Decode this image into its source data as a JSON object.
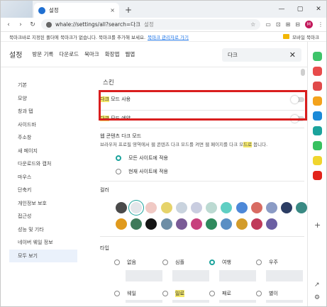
{
  "tab": {
    "title": "설정",
    "close": "×",
    "new": "+"
  },
  "window": {
    "min": "—",
    "max": "▢",
    "close": "✕"
  },
  "address": {
    "scheme": "whale://settings/all?search=",
    "query": "다크",
    "label": "설정"
  },
  "avatar_letter": "M",
  "bookmarks": {
    "notice": "북마크바로 지정된 폴더에 북마크가 없습니다. 북마크를 추가해 보세요.",
    "link": "북마크 관리자로 가기",
    "folder": "모바일 북마크"
  },
  "header": {
    "title": "설정",
    "nav": [
      "방문 기록",
      "다운로드",
      "북마크",
      "확장앱",
      "웹앱"
    ]
  },
  "search": {
    "value": "다크"
  },
  "sidebar": [
    {
      "label": "기본"
    },
    {
      "label": "모양"
    },
    {
      "label": "창과 탭"
    },
    {
      "label": "사이드바"
    },
    {
      "label": "주소창"
    },
    {
      "label": "새 페이지"
    },
    {
      "label": "다운로드와 캡처"
    },
    {
      "label": "마우스"
    },
    {
      "label": "단축키"
    },
    {
      "label": "개인정보 보호"
    },
    {
      "label": "접근성"
    },
    {
      "label": "성능 및 기타"
    },
    {
      "label": "네이버 웨일 정보"
    },
    {
      "label": "모두 보기"
    }
  ],
  "skin": {
    "title": "스킨",
    "dark_use": {
      "hl": "다크",
      "rest": " 모드 사용"
    },
    "dark_reserve": {
      "hl": "다크",
      "rest": " 모드 예약"
    },
    "webcontent_title": "웹 콘텐츠 다크 모드",
    "webcontent_desc_a": "브라우저 프로필 영역에서 웹 콘텐츠 다크 모드를 켜면 웹 페이지를 다크 모",
    "webcontent_desc_hl": "드로",
    "webcontent_desc_b": " 봅니다.",
    "opt_all": "모든 사이트에 적용",
    "opt_current": "현재 사이트에 적용",
    "color_title": "컬러",
    "type_title": "타입",
    "types": [
      "없음",
      "심플",
      "여행",
      "우주",
      "웨일",
      "일로",
      "패로",
      "별이"
    ]
  },
  "colors": {
    "row1": [
      "#4a4a4a",
      "#e3e6ea",
      "#f0c9c4",
      "#e6d36a",
      "#c9d3de",
      "#c9cde0",
      "#bcdad2",
      "#5fcfc3",
      "#4d88d8",
      "#d86b62",
      "#8b9bc5",
      "#2b3c63",
      "#3a8a84"
    ],
    "row2": [
      "#e09a1d",
      "#3f7a5a",
      "#151515",
      "#6e8ea6",
      "#7a5b96",
      "#c7417d",
      "#2f8a5d",
      "#5a8fc4",
      "#d39c2a",
      "#c03a5a",
      "#6b5fa3"
    ]
  },
  "right_icons": [
    "#3ec46a",
    "#e84b4b",
    "#e04a4a",
    "#f3a21c",
    "#1a8ad8",
    "#1ba39c",
    "#37c15f",
    "#f0d52e",
    "#e2231a"
  ]
}
